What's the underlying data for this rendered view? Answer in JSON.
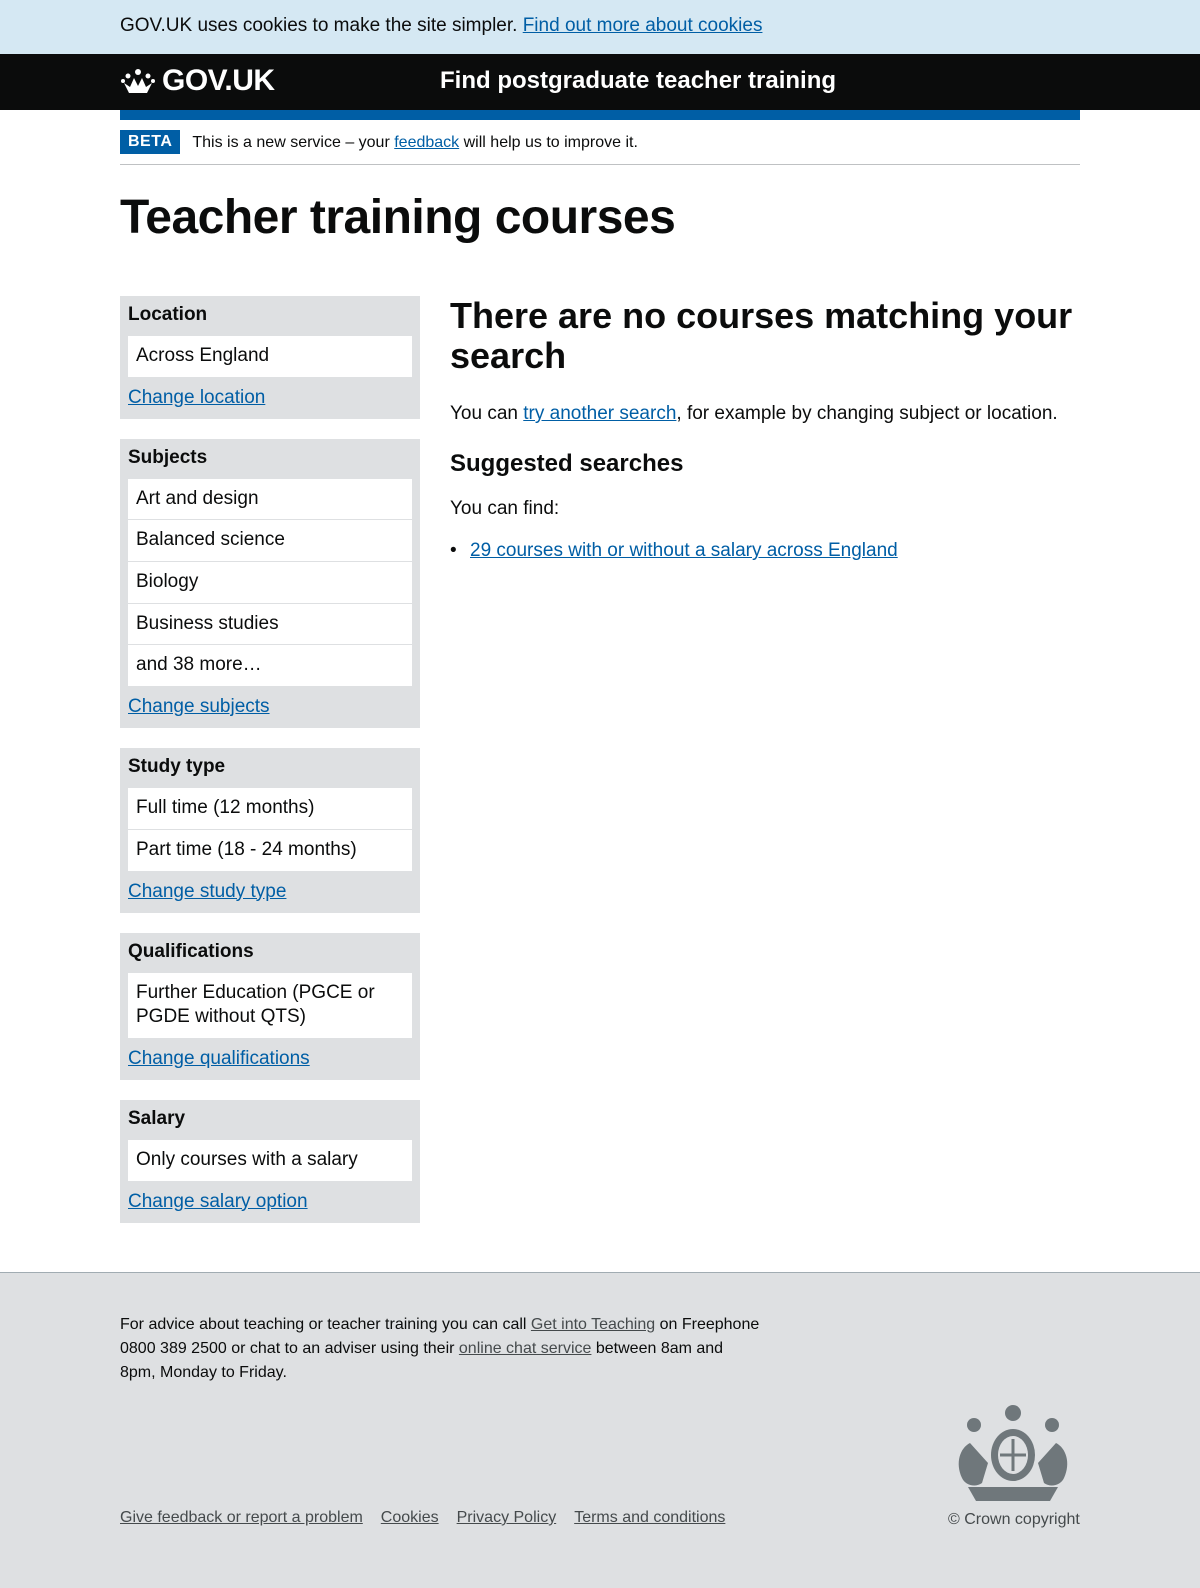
{
  "cookie_banner": {
    "text": "GOV.UK uses cookies to make the site simpler.",
    "link": "Find out more about cookies"
  },
  "header": {
    "logo": "GOV.UK",
    "service_name": "Find postgraduate teacher training"
  },
  "phase_banner": {
    "tag": "BETA",
    "text_before": "This is a new service – your",
    "link": "feedback",
    "text_after": "will help us to improve it."
  },
  "page_title": "Teacher training courses",
  "filters": {
    "location": {
      "heading": "Location",
      "items": [
        "Across England"
      ],
      "change": "Change location"
    },
    "subjects": {
      "heading": "Subjects",
      "items": [
        "Art and design",
        "Balanced science",
        "Biology",
        "Business studies",
        "and 38 more…"
      ],
      "change": "Change subjects"
    },
    "study_type": {
      "heading": "Study type",
      "items": [
        "Full time (12 months)",
        "Part time (18 - 24 months)"
      ],
      "change": "Change study type"
    },
    "qualifications": {
      "heading": "Qualifications",
      "items": [
        "Further Education (PGCE or PGDE without QTS)"
      ],
      "change": "Change qualifications"
    },
    "salary": {
      "heading": "Salary",
      "items": [
        "Only courses with a salary"
      ],
      "change": "Change salary option"
    }
  },
  "results": {
    "heading": "There are no courses matching your search",
    "intro_before": "You can",
    "intro_link": "try another search",
    "intro_after": ", for example by changing subject or location.",
    "suggested_heading": "Suggested searches",
    "suggested_intro": "You can find:",
    "suggestions": [
      "29 courses with or without a salary across England"
    ]
  },
  "footer": {
    "advice_1": "For advice about teaching or teacher training you can call",
    "advice_link_1": "Get into Teaching",
    "advice_2": "on Freephone 0800 389 2500 or chat to an adviser using their",
    "advice_link_2": "online chat service",
    "advice_3": "between 8am and 8pm, Monday to Friday.",
    "links": [
      "Give feedback or report a problem",
      "Cookies",
      "Privacy Policy",
      "Terms and conditions"
    ],
    "copyright": "© Crown copyright",
    "crest_icon": "royal-coat-of-arms-icon"
  }
}
